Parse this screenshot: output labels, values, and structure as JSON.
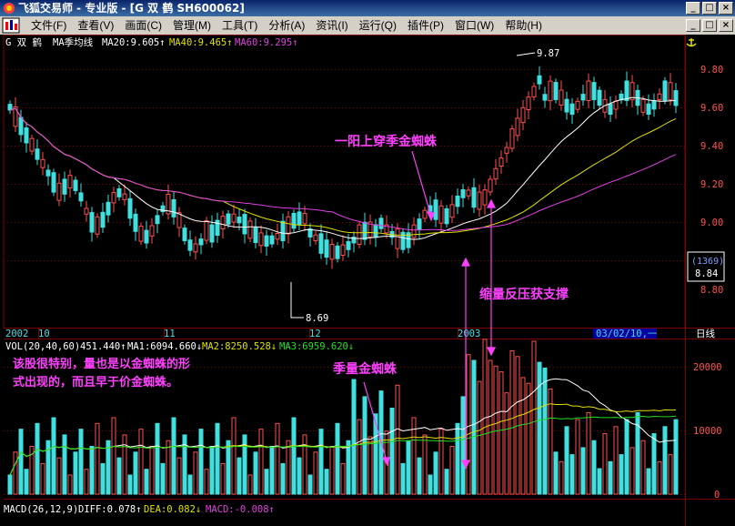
{
  "window": {
    "title": "飞狐交易师 - 专业版 - [G 双 鹤 SH600062]",
    "buttons": [
      "_",
      "□",
      "×"
    ]
  },
  "menu": [
    {
      "label": "文件(F)"
    },
    {
      "label": "查看(V)"
    },
    {
      "label": "画面(C)"
    },
    {
      "label": "管理(M)"
    },
    {
      "label": "工具(T)"
    },
    {
      "label": "分析(A)"
    },
    {
      "label": "资讯(I)"
    },
    {
      "label": "运行(Q)"
    },
    {
      "label": "插件(P)"
    },
    {
      "label": "窗口(W)"
    },
    {
      "label": "帮助(H)"
    }
  ],
  "menu_buttons": [
    "_",
    "□",
    "×"
  ],
  "main": {
    "stock": "G 双  鹤",
    "ma_label": "MA季均线",
    "ma20": "MA20:9.605↑",
    "ma40": "MA40:9.465↑",
    "ma60": "MA60:9.295↑",
    "high_label": "9.87",
    "low_label": "8.69",
    "count_box": "(1369)",
    "price_box": "8.84",
    "axis": [
      "9.80",
      "9.60",
      "9.40",
      "9.20",
      "9.00",
      "8.80"
    ]
  },
  "date_axis": {
    "y2002": "2002",
    "m10": "10",
    "m11": "11",
    "m12": "12",
    "y2003": "2003",
    "cursor_date": "03/02/10,一",
    "period": "日线"
  },
  "volume": {
    "name": "VOL(20,40,60)",
    "value": "451.440↑",
    "ma1": "MA1:6094.660↓",
    "ma2": "MA2:8250.528↓",
    "ma3": "MA3:6959.620↓",
    "axis": [
      "20000",
      "10000",
      "0"
    ]
  },
  "macd": {
    "name": "MACD(26,12,9)",
    "diff": "DIFF:0.078↑",
    "dea": "DEA:0.082↓",
    "macd": "MACD:-0.008↑"
  },
  "annotations": {
    "a1": "一阳上穿季金蜘蛛",
    "a2": "缩量反压获支撑",
    "a3": "季量金蜘蛛",
    "a4_line1": "该股很特别，量也是以金蜘蛛的形",
    "a4_line2": "式出现的，而且早于价金蜘蛛。"
  },
  "colors": {
    "up": "#ff5050",
    "down": "#40e0e0",
    "ma20": "#ffffff",
    "ma40": "#e0e000",
    "ma60": "#e040e0",
    "vma3": "#20e020",
    "annotation": "#ff40ff",
    "grid": "#800000"
  }
}
